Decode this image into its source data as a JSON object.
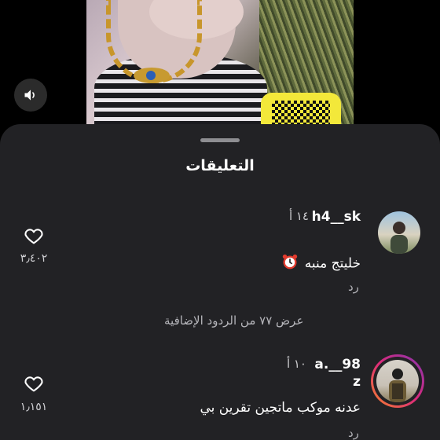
{
  "sheet": {
    "title": "التعليقات"
  },
  "comments": [
    {
      "username": "h4__sk",
      "time": "١٤ أ",
      "text": "خليتج منبه",
      "emoji_icon": "alarm-clock-icon",
      "reply_label": "رد",
      "like_count": "٣٫٤٠٢",
      "more_replies": "عرض ٧٧ من الردود الإضافية"
    },
    {
      "username": "a.__98",
      "username_line2": "z",
      "time": "١٠ أ",
      "text": "عدنه موكب ماتجين تقرين بي",
      "reply_label": "رد",
      "like_count": "١٫١٥١"
    }
  ],
  "icons": {
    "sound": "speaker-icon",
    "like": "heart-outline-icon"
  },
  "colors": {
    "sheet_bg": "#222225",
    "story_ring_start": "#f58529",
    "story_ring_end": "#c13584"
  }
}
